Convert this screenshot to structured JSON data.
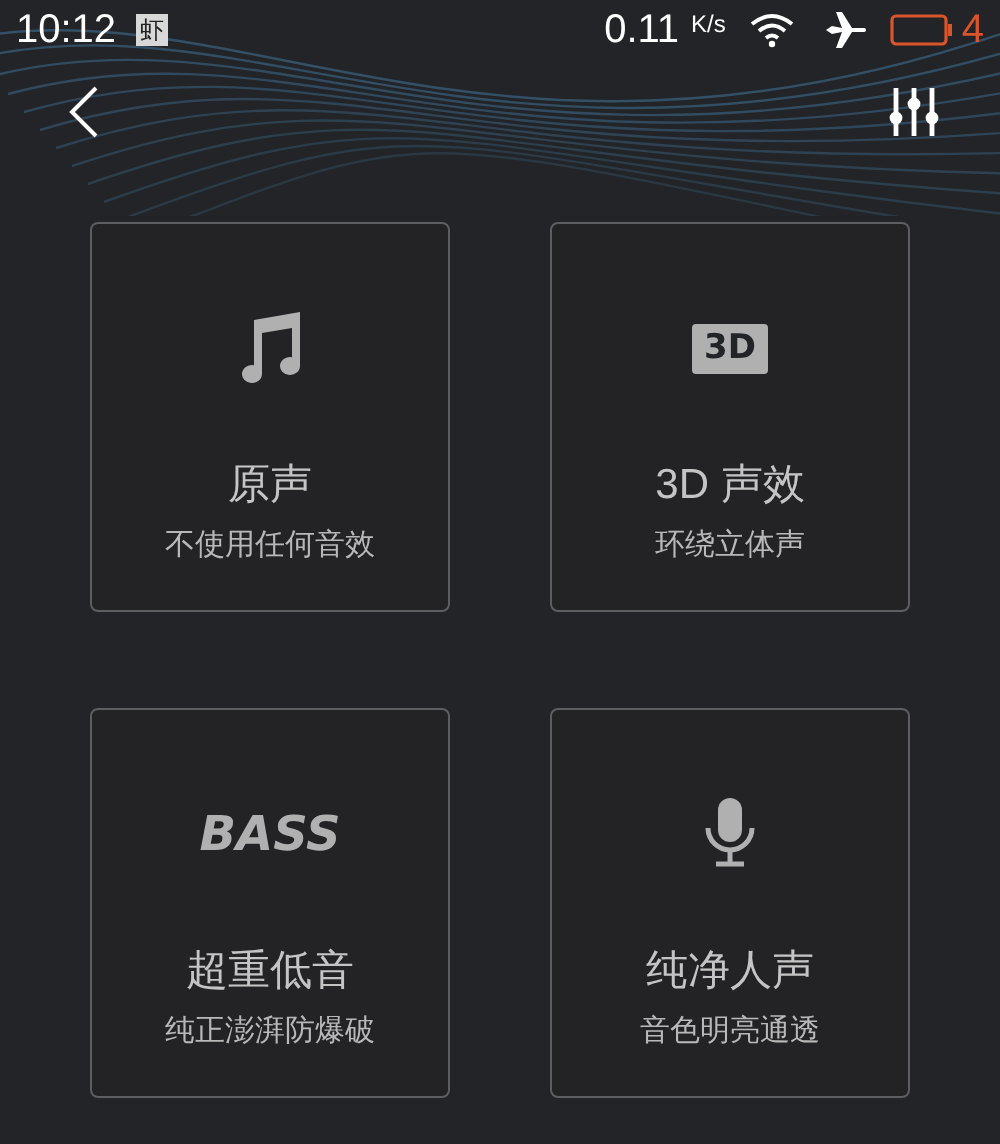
{
  "status_bar": {
    "time": "10:12",
    "app_badge": "虾",
    "speed": "0.11",
    "speed_unit": "K/s",
    "battery_text": "4"
  },
  "cards": [
    {
      "kind": "music",
      "title": "原声",
      "subtitle": "不使用任何音效"
    },
    {
      "kind": "badge",
      "badge": "3D",
      "title": "3D 声效",
      "subtitle": "环绕立体声"
    },
    {
      "kind": "wordmark",
      "badge": "BASS",
      "title": "超重低音",
      "subtitle": "纯正澎湃防爆破"
    },
    {
      "kind": "mic",
      "title": "纯净人声",
      "subtitle": "音色明亮通透"
    }
  ]
}
